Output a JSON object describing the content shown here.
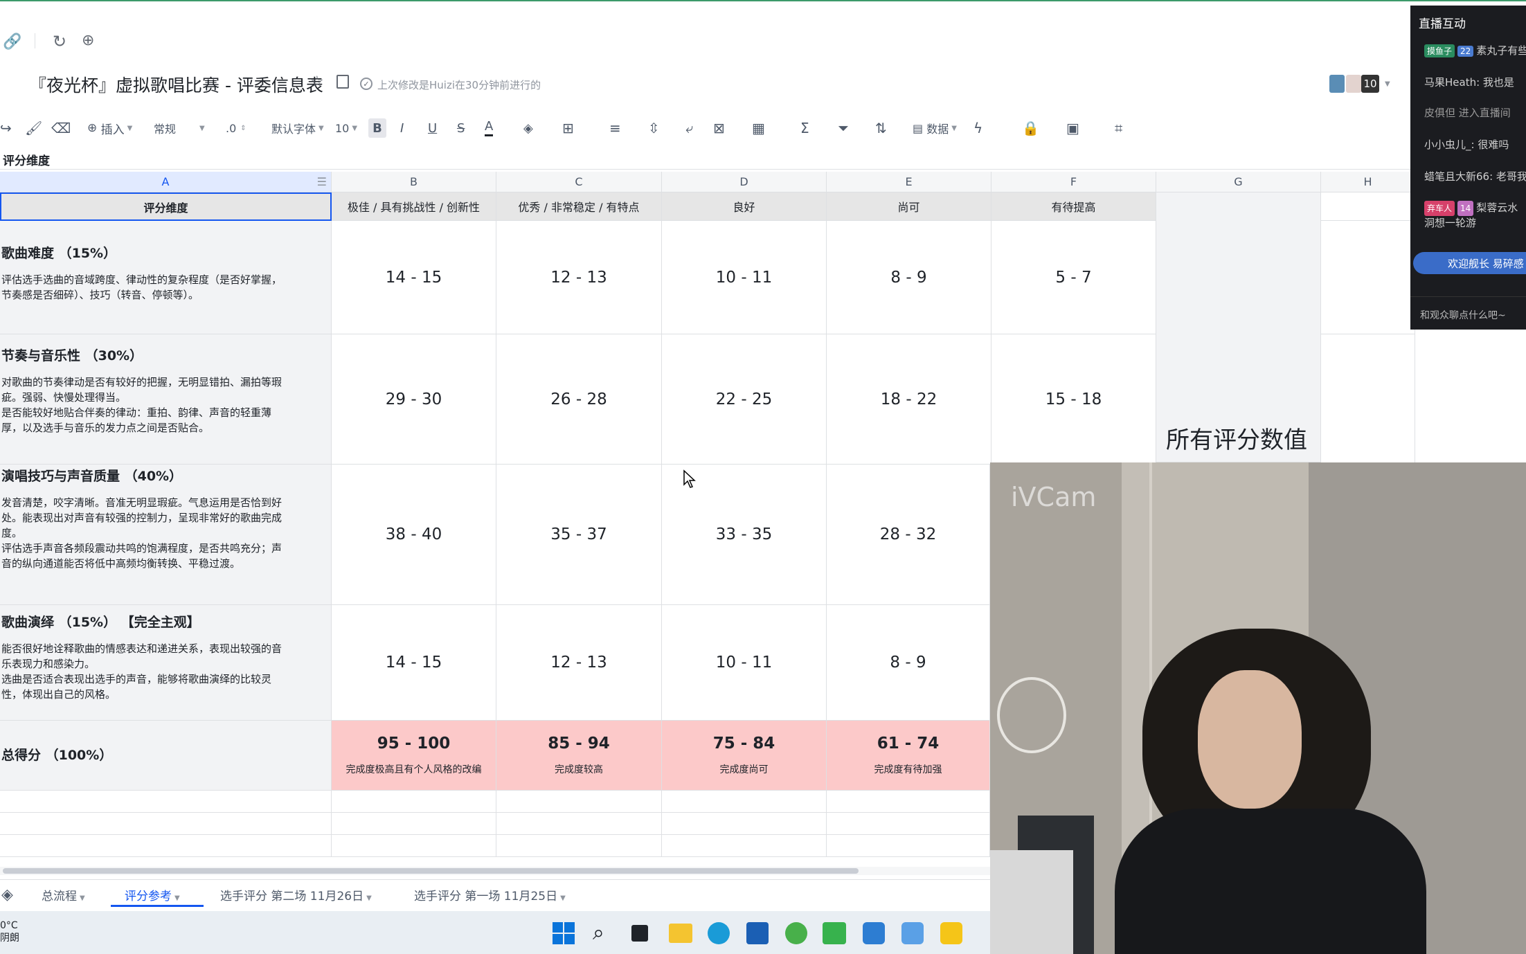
{
  "title_bar": {
    "doc_title": "『夜光杯』虚拟歌唱比赛 - 评委信息表",
    "last_modified": "上次修改是Huizi在30分钟前进行的",
    "collaborator_count": "10"
  },
  "toolbar": {
    "insert": "插入",
    "format": "常规",
    "decimals": ".0",
    "font": "默认字体",
    "font_size": "10",
    "data": "数据"
  },
  "formula_bar": {
    "cell_text": "评分维度"
  },
  "columns": [
    "A",
    "B",
    "C",
    "D",
    "E",
    "F",
    "G",
    "H"
  ],
  "header_row": [
    "评分维度",
    "极佳 / 具有挑战性 / 创新性",
    "优秀 / 非常稳定 / 有特点",
    "良好",
    "尚可",
    "有待提高"
  ],
  "criteria": [
    {
      "title": "歌曲难度 （15%）",
      "desc": "评估选手选曲的音域跨度、律动性的复杂程度（是否好掌握，\n节奏感是否细碎）、技巧（转音、停顿等）。",
      "scores": [
        "14 - 15",
        "12 - 13",
        "10 - 11",
        "8 - 9",
        "5 - 7"
      ]
    },
    {
      "title": "节奏与音乐性 （30%）",
      "desc": "对歌曲的节奏律动是否有较好的把握，无明显错拍、漏拍等瑕\n疵。强弱、快慢处理得当。\n是否能较好地贴合伴奏的律动：重拍、韵律、声音的轻重薄\n厚，以及选手与音乐的发力点之间是否贴合。",
      "scores": [
        "29 - 30",
        "26 - 28",
        "22 - 25",
        "18 - 22",
        "15 - 18"
      ]
    },
    {
      "title": "演唱技巧与声音质量 （40%）",
      "desc": "发音清楚，咬字清晰。音准无明显瑕疵。气息运用是否恰到好\n处。能表现出对声音有较强的控制力，呈现非常好的歌曲完成\n度。\n评估选手声音各频段震动共鸣的饱满程度，是否共鸣充分；声\n音的纵向通道能否将低中高频均衡转换、平稳过渡。",
      "scores": [
        "38 - 40",
        "35 - 37",
        "33 - 35",
        "28 - 32"
      ]
    },
    {
      "title": "歌曲演绎 （15%） 【完全主观】",
      "desc": "能否很好地诠释歌曲的情感表达和递进关系，表现出较强的音\n乐表现力和感染力。\n选曲是否适合表现出选手的声音，能够将歌曲演绎的比较灵\n性，体现出自己的风格。",
      "scores": [
        "14 - 15",
        "12 - 13",
        "10 - 11",
        "8 - 9"
      ]
    }
  ],
  "total": {
    "title": "总得分 （100%）",
    "ranges": [
      "95 - 100",
      "85 - 94",
      "75 - 84",
      "61 - 74"
    ],
    "notes": [
      "完成度极高且有个人风格的改编",
      "完成度较高",
      "完成度尚可",
      "完成度有待加强"
    ]
  },
  "merged_g_text": "所有评分数值",
  "sheet_tabs": [
    "总流程",
    "评分参考",
    "选手评分 第二场 11月26日",
    "选手评分 第一场 11月25日"
  ],
  "active_tab": "评分参考",
  "weather": {
    "temp": "0°C",
    "cond": "阴朗"
  },
  "live_panel": {
    "title": "直播互动",
    "messages": [
      {
        "badge": "摸鱼子",
        "level": "22",
        "text": "素丸子有些"
      },
      {
        "text": "马果Heath: 我也是"
      },
      {
        "text": "皮俱但 进入直播间"
      },
      {
        "text": "小小虫儿_: 很难吗"
      },
      {
        "text": "蜡笔且大新66: 老哥我"
      },
      {
        "badge": "弃车人",
        "level": "14",
        "text": "梨蓉云水洞想一轮游"
      },
      {
        "text": "欢迎舰长 易碎感"
      }
    ],
    "input_placeholder": "和观众聊点什么吧~"
  },
  "webcam": {
    "watermark": "iVCam"
  }
}
